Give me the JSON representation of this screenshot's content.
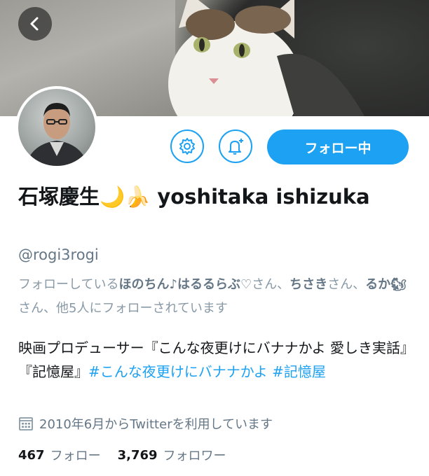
{
  "profile": {
    "name_jp": "石塚慶生",
    "emoji1": "🌙",
    "emoji2": "🍌",
    "name_en": "yoshitaka ishizuka",
    "handle": "@rogi3rogi"
  },
  "actions": {
    "follow_label": "フォロー中",
    "settings_icon": "gear-icon",
    "notify_icon": "bell-plus-icon",
    "back_icon": "chevron-left-icon"
  },
  "followed_by": {
    "prefix": "フォローしている",
    "user1": "ほのちん♪はるるらぶ♡",
    "san1": "さん、",
    "user2": "ちさき",
    "san2": "さん、",
    "user3": "るか🐿",
    "suffix": "さん、他5人にフォローされています"
  },
  "bio": {
    "text": "映画プロデューサー『こんな夜更けにバナナかよ 愛しき実話』『記憶屋』",
    "tag1": "#こんな夜更けにバナナかよ",
    "tag2": "#記憶屋"
  },
  "joined": "2010年6月からTwitterを利用しています",
  "stats": {
    "following_count": "467",
    "following_label": "フォロー",
    "followers_count": "3,769",
    "followers_label": "フォロワー"
  },
  "colors": {
    "accent": "#1da1f2",
    "secondary_text": "#657786"
  }
}
